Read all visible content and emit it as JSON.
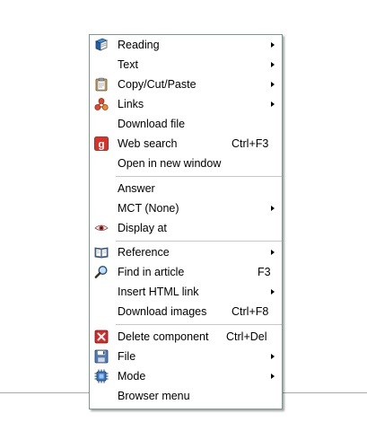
{
  "menu": {
    "items": [
      {
        "label": "Reading",
        "icon": "book-icon",
        "has_submenu": true
      },
      {
        "label": "Text",
        "icon": "",
        "has_submenu": true
      },
      {
        "label": "Copy/Cut/Paste",
        "icon": "clipboard-icon",
        "has_submenu": true
      },
      {
        "label": "Links",
        "icon": "link-nodes-icon",
        "has_submenu": true
      },
      {
        "label": "Download file",
        "icon": "",
        "has_submenu": false
      },
      {
        "label": "Web search",
        "icon": "google-g-icon",
        "shortcut": "Ctrl+F3",
        "has_submenu": false
      },
      {
        "label": "Open in new window",
        "icon": "",
        "has_submenu": false
      },
      {
        "label": "Answer",
        "icon": "",
        "has_submenu": false
      },
      {
        "label": "MCT (None)",
        "icon": "",
        "has_submenu": true
      },
      {
        "label": "Display at",
        "icon": "eye-icon",
        "has_submenu": false
      },
      {
        "label": "Reference",
        "icon": "open-book-icon",
        "has_submenu": true
      },
      {
        "label": "Find in article",
        "icon": "magnifier-icon",
        "shortcut": "F3",
        "has_submenu": false
      },
      {
        "label": "Insert HTML link",
        "icon": "",
        "has_submenu": true
      },
      {
        "label": "Download images",
        "icon": "",
        "shortcut": "Ctrl+F8",
        "has_submenu": false
      },
      {
        "label": "Delete component",
        "icon": "delete-x-icon",
        "shortcut": "Ctrl+Del",
        "has_submenu": false
      },
      {
        "label": "File",
        "icon": "floppy-disk-icon",
        "has_submenu": true
      },
      {
        "label": "Mode",
        "icon": "chip-icon",
        "has_submenu": true
      },
      {
        "label": "Browser menu",
        "icon": "",
        "has_submenu": false
      }
    ]
  },
  "colors": {
    "menu_border": "#7a9a8e",
    "separator": "#c8c8c8",
    "delete_red": "#d42a2a",
    "google_red": "#d6342b"
  }
}
